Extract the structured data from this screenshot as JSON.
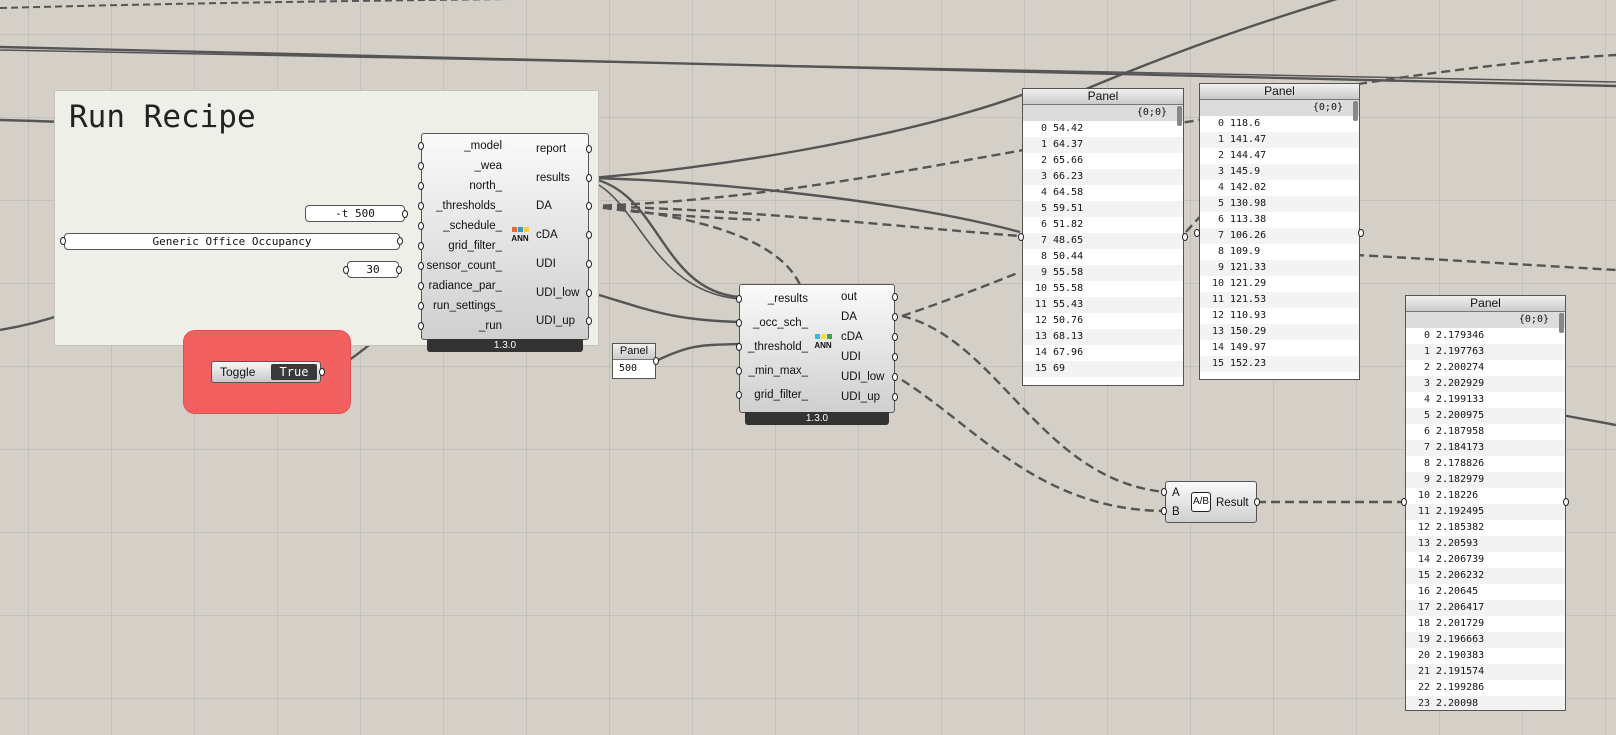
{
  "group": {
    "title": "Run Recipe"
  },
  "annual_daylight": {
    "version": "1.3.0",
    "inputs": [
      "_model",
      "_wea",
      "north_",
      "_thresholds_",
      "_schedule_",
      "grid_filter_",
      "sensor_count_",
      "radiance_par_",
      "run_settings_",
      "_run"
    ],
    "outputs": [
      "report",
      "results",
      "DA",
      "cDA",
      "UDI",
      "UDI_low",
      "UDI_up"
    ],
    "icon_text": "ANN"
  },
  "daylight_metrics": {
    "version": "1.3.0",
    "inputs": [
      "_results",
      "_occ_sch_",
      "_threshold_",
      "_min_max_",
      "grid_filter_"
    ],
    "outputs": [
      "out",
      "DA",
      "cDA",
      "UDI",
      "UDI_low",
      "UDI_up"
    ],
    "icon_text": "ANN"
  },
  "params": {
    "thresholds": "-t 500",
    "schedule": "Generic Office Occupancy",
    "sensor_count": "30"
  },
  "toggle": {
    "label": "Toggle",
    "value": "True"
  },
  "threshold_panel": {
    "title": "Panel",
    "value": "500"
  },
  "division": {
    "input_a": "A",
    "input_b": "B",
    "output": "Result"
  },
  "panel1": {
    "title": "Panel",
    "path": "{0;0}",
    "rows": [
      "54.42",
      "64.37",
      "65.66",
      "66.23",
      "64.58",
      "59.51",
      "51.82",
      "48.65",
      "50.44",
      "55.58",
      "55.58",
      "55.43",
      "50.76",
      "68.13",
      "67.96",
      "69"
    ]
  },
  "panel2": {
    "title": "Panel",
    "path": "{0;0}",
    "rows": [
      "118.6",
      "141.47",
      "144.47",
      "145.9",
      "142.02",
      "130.98",
      "113.38",
      "106.26",
      "109.9",
      "121.33",
      "121.29",
      "121.53",
      "110.93",
      "150.29",
      "149.97",
      "152.23"
    ]
  },
  "panel3": {
    "title": "Panel",
    "path": "{0;0}",
    "rows": [
      "2.179346",
      "2.197763",
      "2.200274",
      "2.202929",
      "2.199133",
      "2.200975",
      "2.187958",
      "2.184173",
      "2.178826",
      "2.182979",
      "2.18226",
      "2.192495",
      "2.185382",
      "2.20593",
      "2.206739",
      "2.206232",
      "2.20645",
      "2.206417",
      "2.201729",
      "2.196663",
      "2.190383",
      "2.191574",
      "2.199286",
      "2.20098"
    ]
  }
}
